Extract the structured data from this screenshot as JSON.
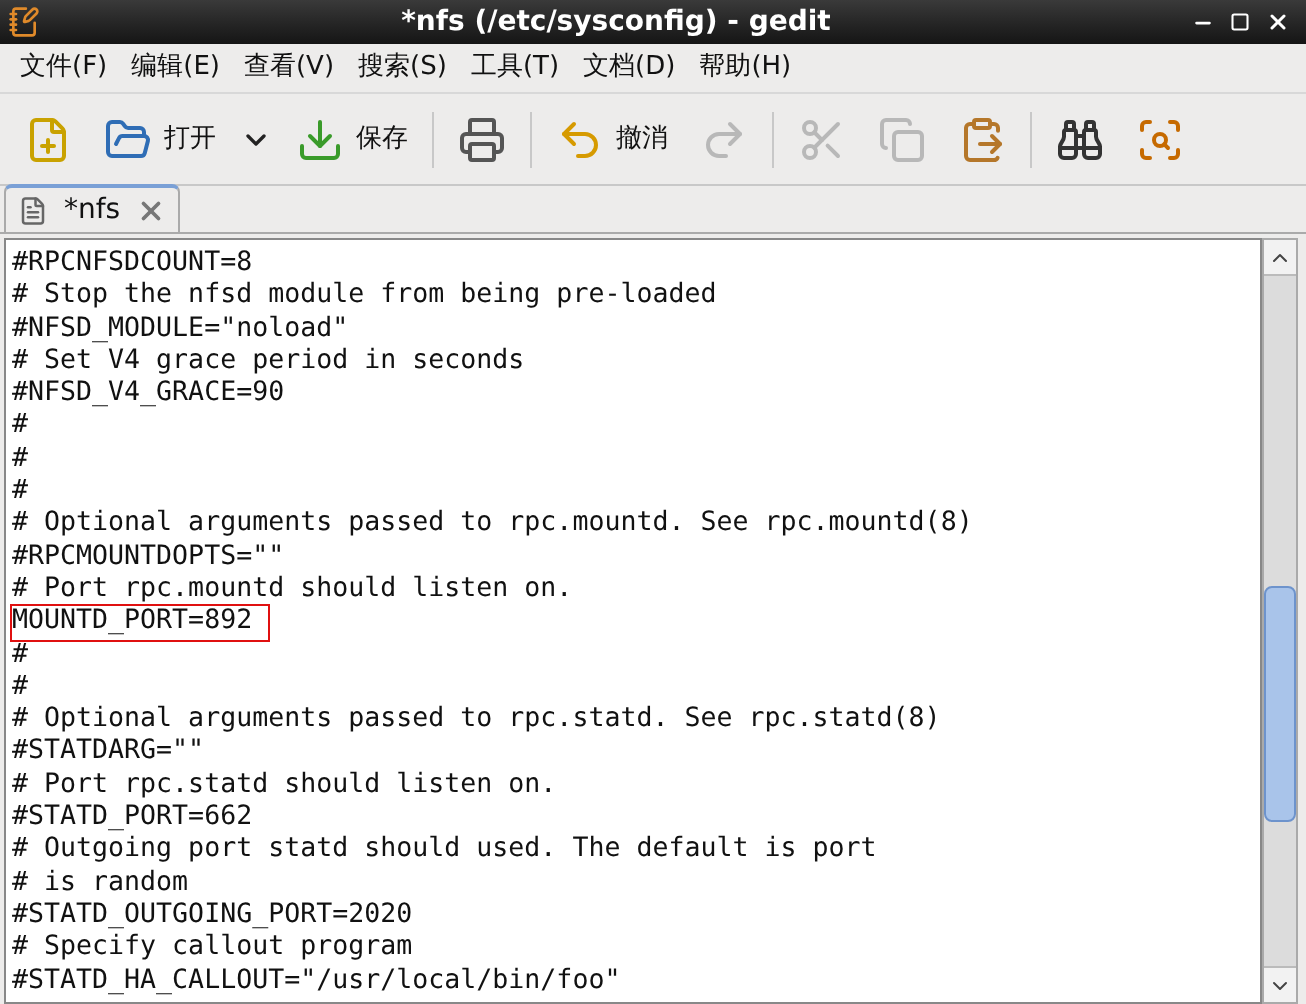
{
  "window": {
    "title": "*nfs (/etc/sysconfig) - gedit"
  },
  "menu": [
    "文件(F)",
    "编辑(E)",
    "查看(V)",
    "搜索(S)",
    "工具(T)",
    "文档(D)",
    "帮助(H)"
  ],
  "toolbar": [
    {
      "kind": "button",
      "disabled": false
    },
    {
      "kind": "button",
      "label": "打开",
      "disabled": false
    },
    {
      "kind": "dropdown",
      "disabled": false
    },
    {
      "kind": "button",
      "label": "保存",
      "disabled": false
    },
    {
      "kind": "separator"
    },
    {
      "kind": "button",
      "disabled": false
    },
    {
      "kind": "separator"
    },
    {
      "kind": "button",
      "label": "撤消",
      "disabled": false
    },
    {
      "kind": "button",
      "disabled": true
    },
    {
      "kind": "separator"
    },
    {
      "kind": "button",
      "disabled": true
    },
    {
      "kind": "button",
      "disabled": true
    },
    {
      "kind": "button",
      "disabled": false
    },
    {
      "kind": "separator"
    },
    {
      "kind": "button",
      "disabled": false
    },
    {
      "kind": "button",
      "disabled": false
    }
  ],
  "tabs": [
    {
      "label": "*nfs",
      "selected": true
    }
  ],
  "editor": {
    "lines": [
      {
        "text": "#RPCNFSDCOUNT=8",
        "highlighted": false
      },
      {
        "text": "# Stop the nfsd module from being pre-loaded",
        "highlighted": false
      },
      {
        "text": "#NFSD_MODULE=\"noload\"",
        "highlighted": false
      },
      {
        "text": "# Set V4 grace period in seconds",
        "highlighted": false
      },
      {
        "text": "#NFSD_V4_GRACE=90",
        "highlighted": false
      },
      {
        "text": "#",
        "highlighted": false
      },
      {
        "text": "#",
        "highlighted": false
      },
      {
        "text": "#",
        "highlighted": false
      },
      {
        "text": "# Optional arguments passed to rpc.mountd. See rpc.mountd(8)",
        "highlighted": false
      },
      {
        "text": "#RPCMOUNTDOPTS=\"\"",
        "highlighted": false
      },
      {
        "text": "# Port rpc.mountd should listen on.",
        "highlighted": false
      },
      {
        "text": "MOUNTD_PORT=892",
        "highlighted": true
      },
      {
        "text": "#",
        "highlighted": false
      },
      {
        "text": "#",
        "highlighted": false
      },
      {
        "text": "# Optional arguments passed to rpc.statd. See rpc.statd(8)",
        "highlighted": false
      },
      {
        "text": "#STATDARG=\"\"",
        "highlighted": false
      },
      {
        "text": "# Port rpc.statd should listen on.",
        "highlighted": false
      },
      {
        "text": "#STATD_PORT=662",
        "highlighted": false
      },
      {
        "text": "# Outgoing port statd should used. The default is port",
        "highlighted": false
      },
      {
        "text": "# is random",
        "highlighted": false
      },
      {
        "text": "#STATD_OUTGOING_PORT=2020",
        "highlighted": false
      },
      {
        "text": "# Specify callout program",
        "highlighted": false
      },
      {
        "text": "#STATD_HA_CALLOUT=\"/usr/local/bin/foo\"",
        "highlighted": false
      }
    ]
  }
}
